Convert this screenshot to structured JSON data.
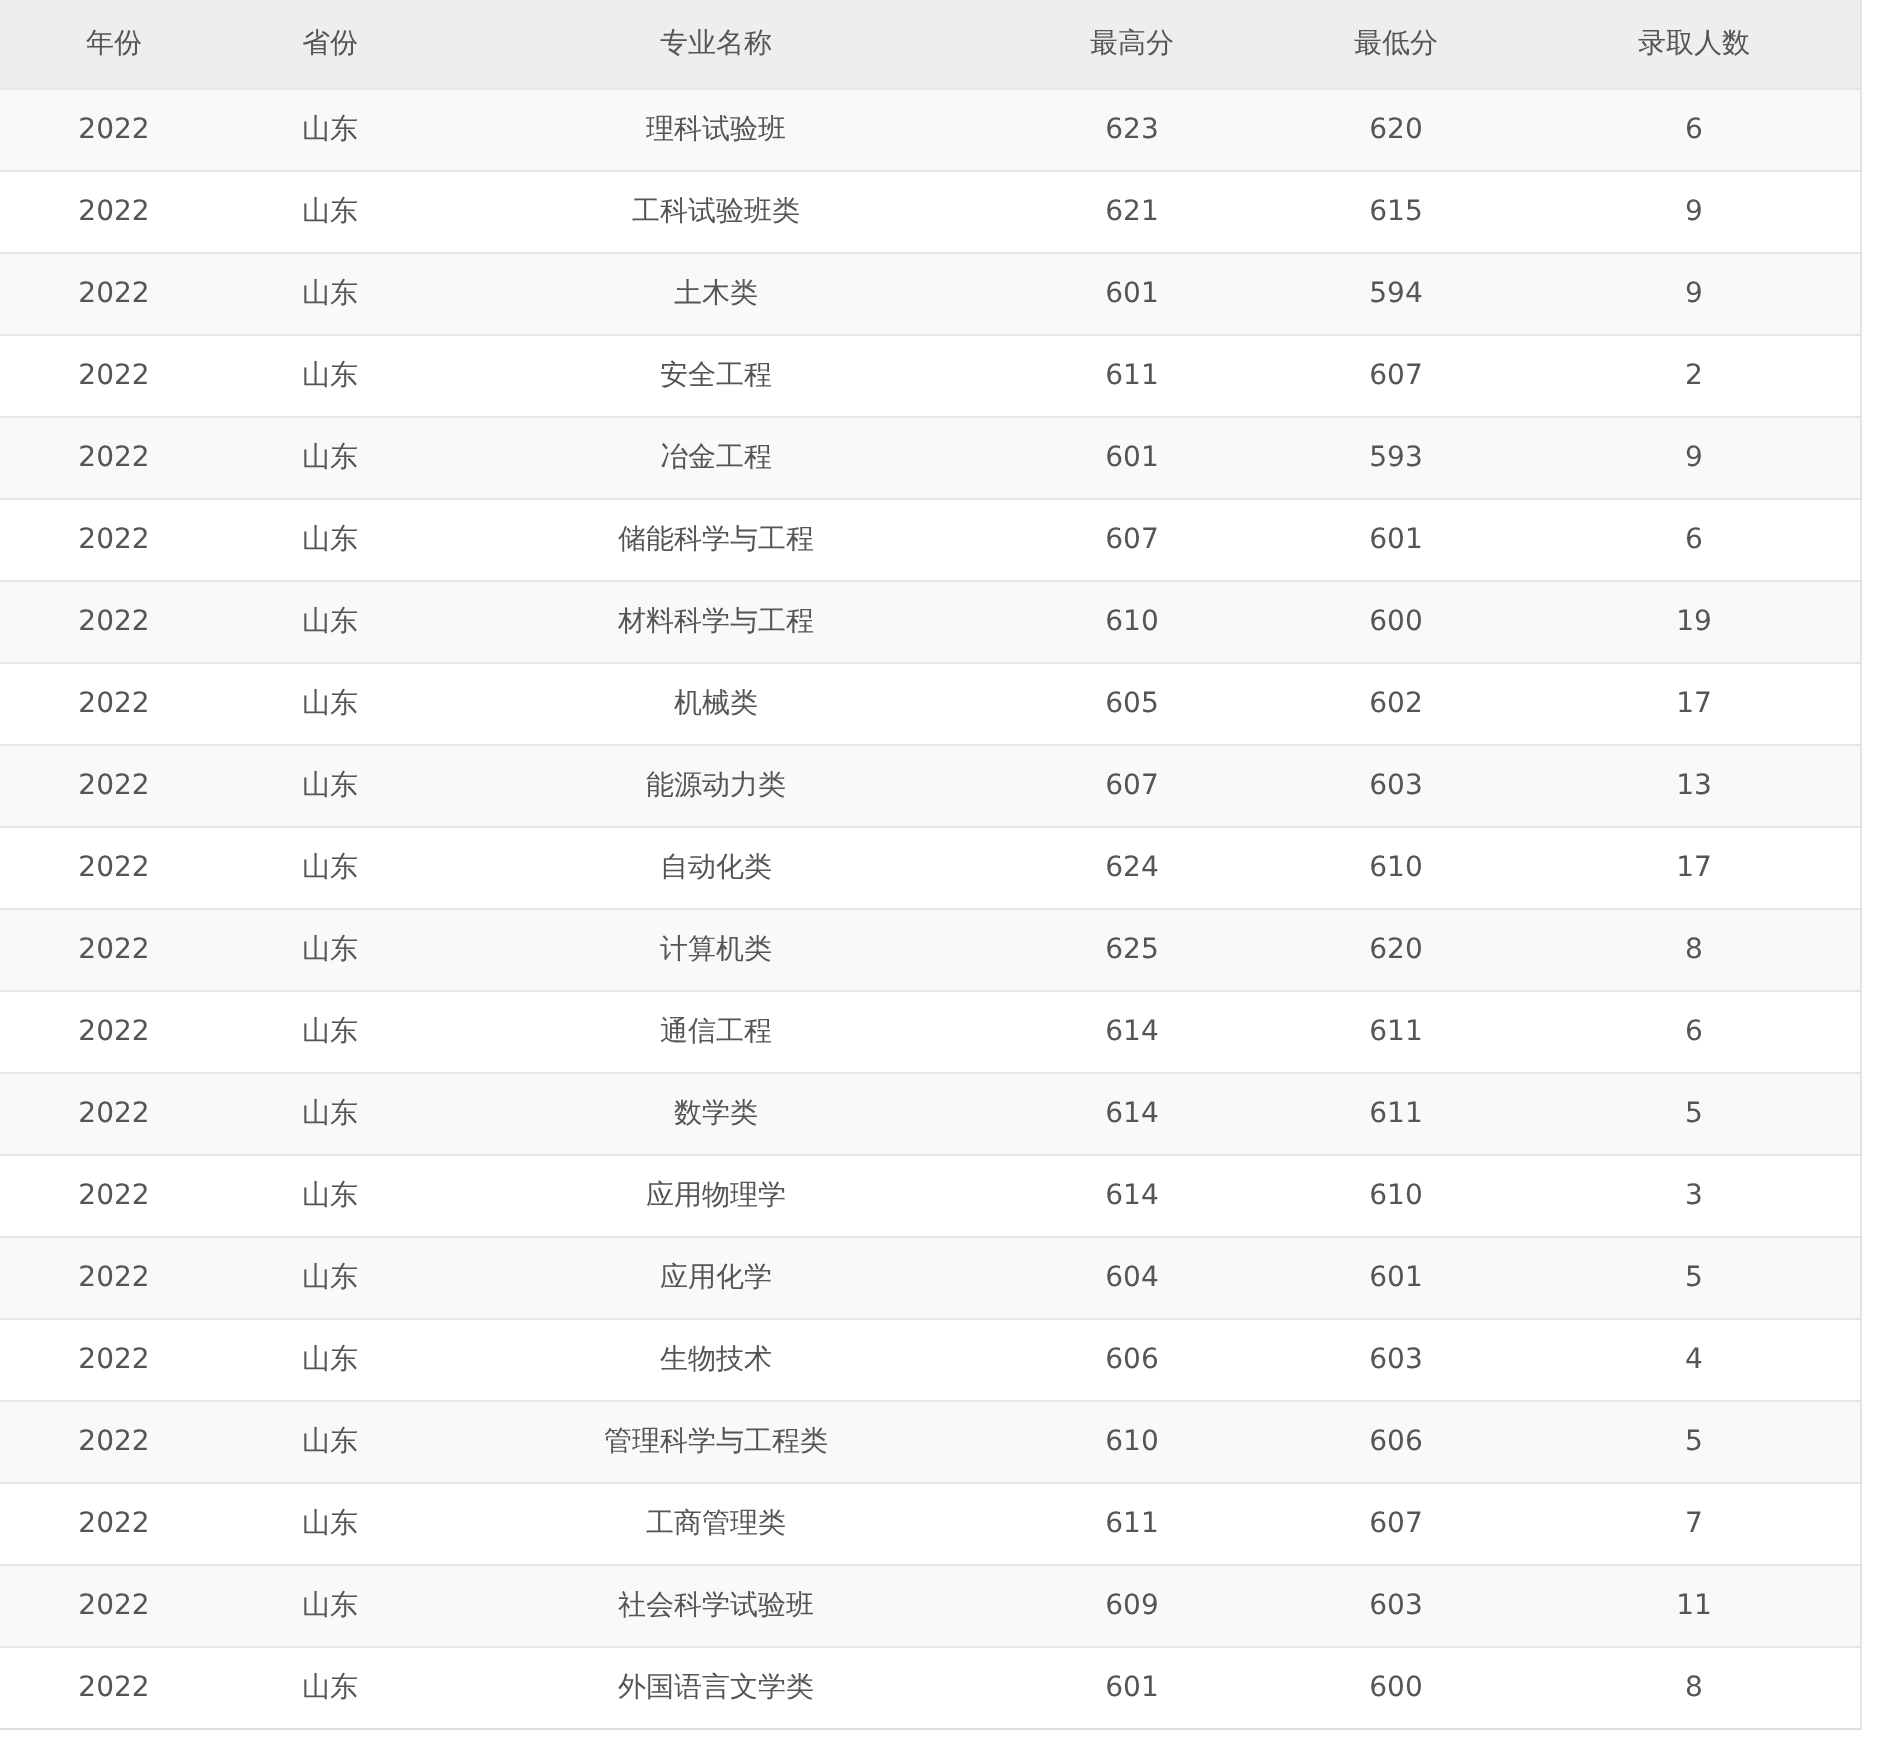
{
  "table": {
    "columns": [
      "年份",
      "省份",
      "专业名称",
      "最高分",
      "最低分",
      "录取人数"
    ],
    "rows": [
      [
        "2022",
        "山东",
        "理科试验班",
        "623",
        "620",
        "6"
      ],
      [
        "2022",
        "山东",
        "工科试验班类",
        "621",
        "615",
        "9"
      ],
      [
        "2022",
        "山东",
        "土木类",
        "601",
        "594",
        "9"
      ],
      [
        "2022",
        "山东",
        "安全工程",
        "611",
        "607",
        "2"
      ],
      [
        "2022",
        "山东",
        "冶金工程",
        "601",
        "593",
        "9"
      ],
      [
        "2022",
        "山东",
        "储能科学与工程",
        "607",
        "601",
        "6"
      ],
      [
        "2022",
        "山东",
        "材料科学与工程",
        "610",
        "600",
        "19"
      ],
      [
        "2022",
        "山东",
        "机械类",
        "605",
        "602",
        "17"
      ],
      [
        "2022",
        "山东",
        "能源动力类",
        "607",
        "603",
        "13"
      ],
      [
        "2022",
        "山东",
        "自动化类",
        "624",
        "610",
        "17"
      ],
      [
        "2022",
        "山东",
        "计算机类",
        "625",
        "620",
        "8"
      ],
      [
        "2022",
        "山东",
        "通信工程",
        "614",
        "611",
        "6"
      ],
      [
        "2022",
        "山东",
        "数学类",
        "614",
        "611",
        "5"
      ],
      [
        "2022",
        "山东",
        "应用物理学",
        "614",
        "610",
        "3"
      ],
      [
        "2022",
        "山东",
        "应用化学",
        "604",
        "601",
        "5"
      ],
      [
        "2022",
        "山东",
        "生物技术",
        "606",
        "603",
        "4"
      ],
      [
        "2022",
        "山东",
        "管理科学与工程类",
        "610",
        "606",
        "5"
      ],
      [
        "2022",
        "山东",
        "工商管理类",
        "611",
        "607",
        "7"
      ],
      [
        "2022",
        "山东",
        "社会科学试验班",
        "609",
        "603",
        "11"
      ],
      [
        "2022",
        "山东",
        "外国语言文学类",
        "601",
        "600",
        "8"
      ]
    ]
  }
}
